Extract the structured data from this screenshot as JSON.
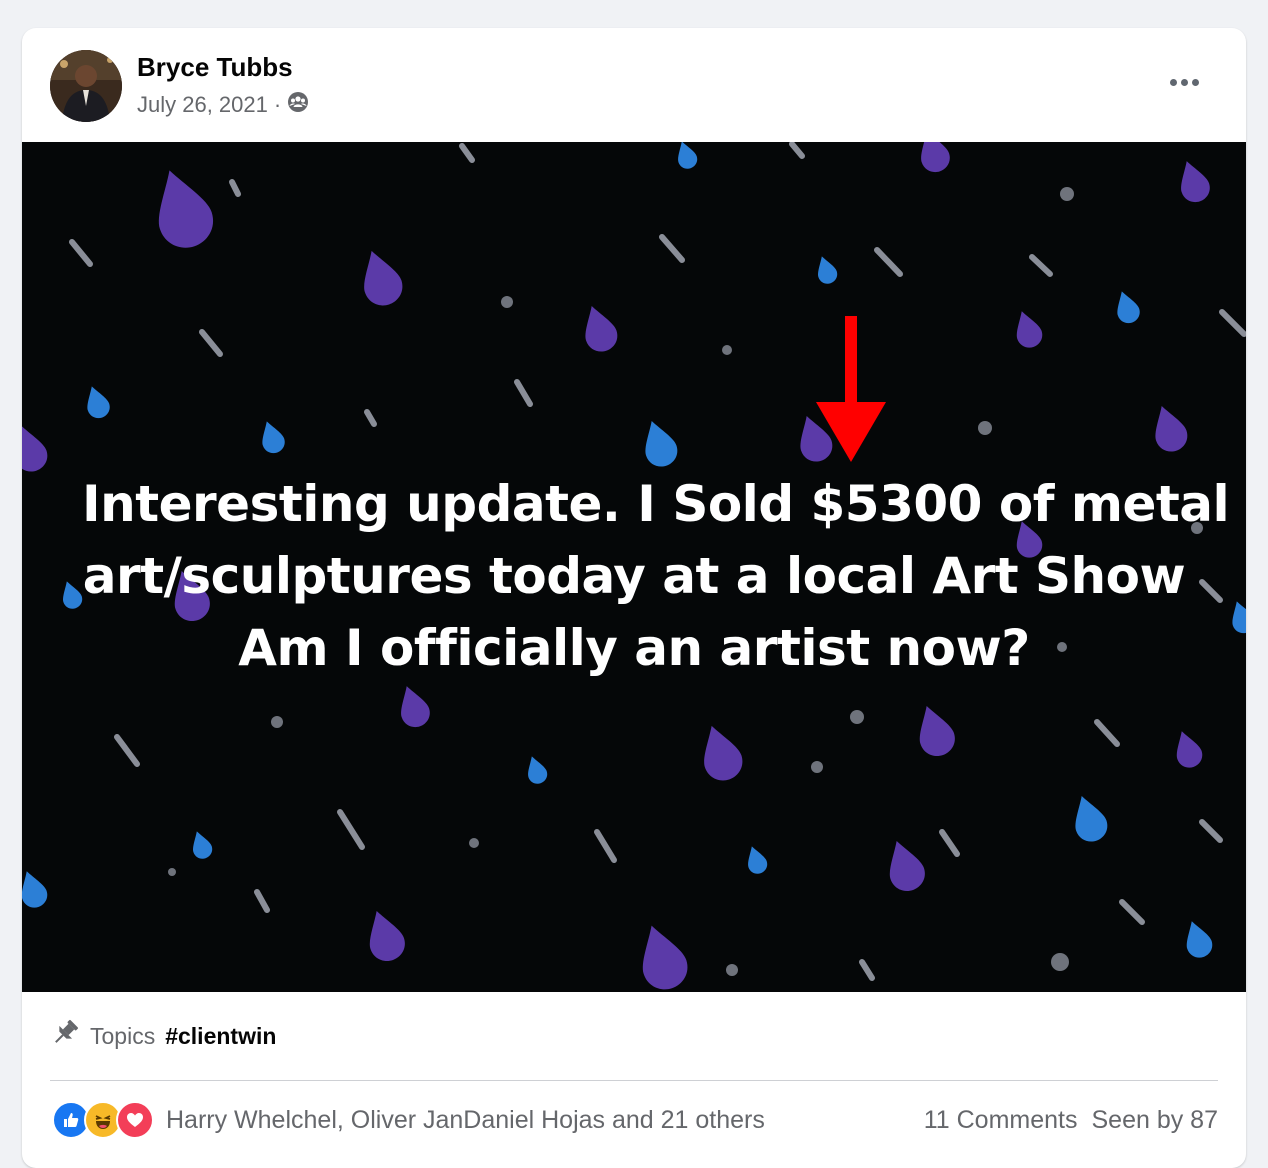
{
  "post": {
    "author": "Bryce Tubbs",
    "date": "July 26, 2021",
    "separator": "·",
    "audience_icon": "group-icon",
    "more_icon": "more-options-icon",
    "image_text_lines": [
      "Interesting update. I Sold $5300 of metal",
      "art/sculptures today at a local Art Show",
      "Am I officially an artist now?"
    ],
    "background_theme": "night-rain-drops",
    "annotation": "red-down-arrow"
  },
  "topics": {
    "icon": "pushpin-icon",
    "label": "Topics",
    "tag": "#clientwin"
  },
  "reactions": {
    "icons": [
      "like-icon",
      "haha-icon",
      "love-icon"
    ],
    "reactors_text": "Harry Whelchel, Oliver JanDaniel Hojas and 21 others",
    "comments": "11 Comments",
    "seen_by": "Seen by 87"
  },
  "colors": {
    "like": "#1877f2",
    "haha": "#f7b928",
    "love": "#f33e58",
    "arrow": "#ff0000",
    "drop_purple": "#5b3aa8",
    "drop_blue": "#2c7fd6",
    "drop_gray": "#b7bcc8"
  }
}
